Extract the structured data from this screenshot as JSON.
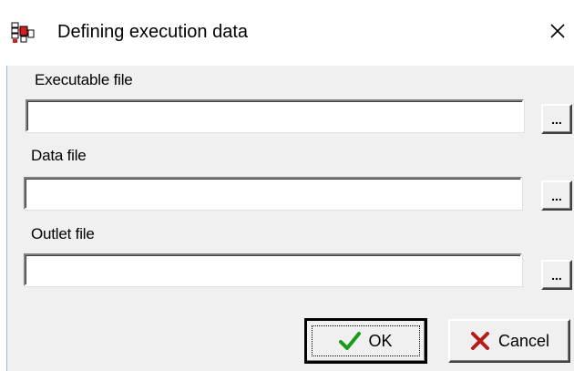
{
  "window": {
    "title": "Defining execution data"
  },
  "fields": {
    "executable": {
      "label": "Executable file",
      "value": "",
      "browse_label": "..."
    },
    "data": {
      "label": "Data file",
      "value": "",
      "browse_label": "..."
    },
    "outlet": {
      "label": "Outlet file",
      "value": "",
      "browse_label": "..."
    }
  },
  "buttons": {
    "ok_label": "OK",
    "cancel_label": "Cancel"
  },
  "icons": {
    "app": "app-icon",
    "close": "close-icon",
    "ok": "checkmark-icon",
    "cancel": "x-mark-icon"
  },
  "colors": {
    "ok_check": "#1a9a1a",
    "cancel_x": "#b81a1a",
    "dialog_background": "#f0f0f0"
  }
}
